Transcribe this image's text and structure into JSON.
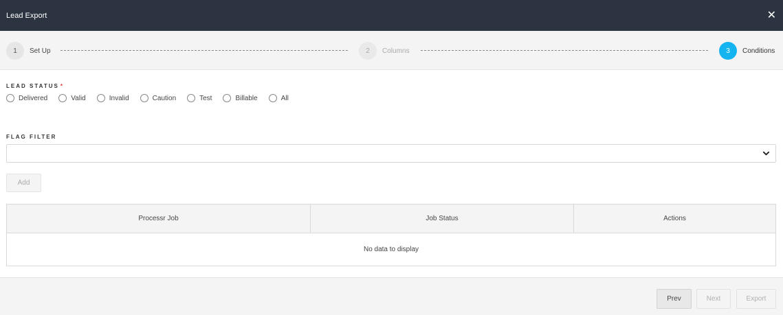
{
  "header": {
    "title": "Lead Export",
    "close_glyph": "✕"
  },
  "steps": [
    {
      "number": "1",
      "label": "Set Up",
      "state": "complete"
    },
    {
      "number": "2",
      "label": "Columns",
      "state": "inactive"
    },
    {
      "number": "3",
      "label": "Conditions",
      "state": "active"
    }
  ],
  "lead_status": {
    "label": "LEAD STATUS",
    "required_mark": "*",
    "options": [
      "Delivered",
      "Valid",
      "Invalid",
      "Caution",
      "Test",
      "Billable",
      "All"
    ]
  },
  "flag_filter": {
    "label": "FLAG FILTER",
    "value": ""
  },
  "add_button": {
    "label": "Add"
  },
  "table": {
    "columns": [
      "Processr Job",
      "Job Status",
      "Actions"
    ],
    "empty_text": "No data to display"
  },
  "footer": {
    "prev_label": "Prev",
    "next_label": "Next",
    "export_label": "Export"
  },
  "colors": {
    "header_bg": "#2b3440",
    "active_step": "#14b4f0",
    "required": "#e53935"
  }
}
